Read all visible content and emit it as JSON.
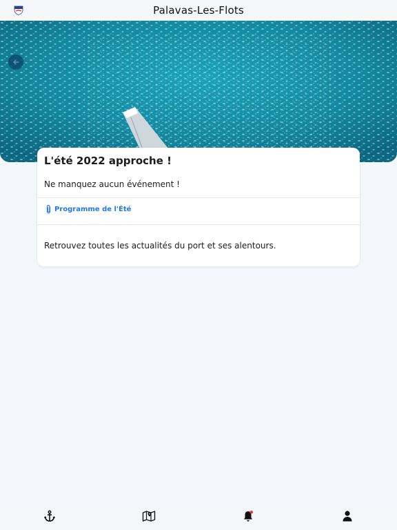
{
  "header": {
    "title": "Palavas-Les-Flots"
  },
  "hero": {
    "back_icon": "arrow-left-icon"
  },
  "card": {
    "title": "L'été 2022 approche !",
    "subtitle": "Ne manquez aucun événement !",
    "attachment_label": "Programme de l'Été",
    "body": "Retrouvez toutes les actualités du port et ses alentours."
  },
  "tabs": [
    {
      "icon": "anchor-icon"
    },
    {
      "icon": "map-icon"
    },
    {
      "icon": "bell-icon"
    },
    {
      "icon": "user-icon"
    }
  ],
  "colors": {
    "accent": "#1f7ae0",
    "background": "#f3f6fa",
    "water": "#14879f",
    "notification_dot": "#e53935"
  }
}
